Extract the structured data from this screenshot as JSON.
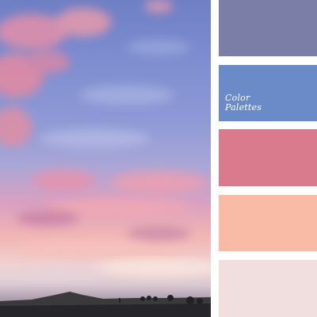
{
  "brand": {
    "line1": "Color",
    "line2": "Palettes"
  },
  "palette": {
    "swatches": [
      {
        "name": "swatch-slate-purple",
        "color": "#7b7ea6"
      },
      {
        "name": "swatch-cornflower-blue",
        "color": "#6a8bc7"
      },
      {
        "name": "swatch-rose",
        "color": "#d97a8d"
      },
      {
        "name": "swatch-peach",
        "color": "#f9bba6"
      },
      {
        "name": "swatch-pale-pink",
        "color": "#f1dede"
      }
    ]
  },
  "photo": {
    "subject": "sunset-sky-photo"
  }
}
